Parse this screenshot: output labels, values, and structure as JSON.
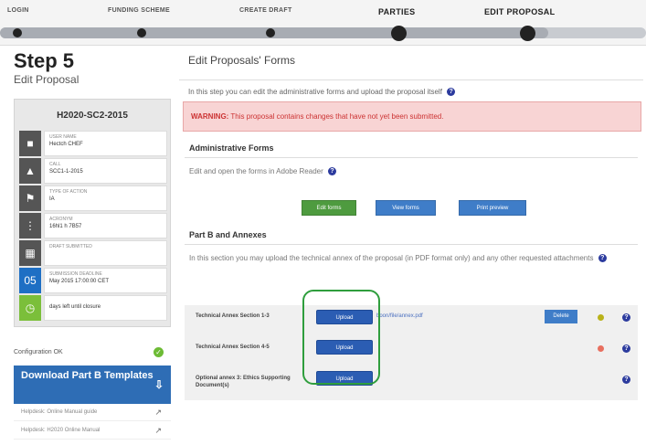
{
  "progress": {
    "steps": [
      {
        "label": "LOGIN",
        "active": false
      },
      {
        "label": "FUNDING SCHEME",
        "active": false
      },
      {
        "label": "CREATE DRAFT",
        "active": false
      },
      {
        "label": "PARTIES",
        "active": true
      },
      {
        "label": "EDIT PROPOSAL",
        "active": true
      }
    ]
  },
  "sidebar": {
    "step_title": "Step 5",
    "step_subtitle": "Edit Proposal",
    "proposal_id": "H2020-SC2-2015",
    "rows": [
      {
        "icon": "person-icon",
        "label": "USER NAME",
        "value": "Hectch CHEF"
      },
      {
        "icon": "call-icon",
        "label": "CALL",
        "value": "SCC1-1-2015"
      },
      {
        "icon": "topic-icon",
        "label": "TYPE OF ACTION",
        "value": "IA"
      },
      {
        "icon": "acronym-icon",
        "label": "ACRONYM",
        "value": "16hl1 h 7B57"
      },
      {
        "icon": "document-icon",
        "label": "DRAFT SUBMITTED",
        "value": ""
      },
      {
        "icon": "calendar-icon",
        "date": "05",
        "label": "SUBMISSION DEADLINE",
        "value": "May 2015 17:00:00 CET"
      },
      {
        "icon": "time-icon",
        "label": "",
        "value": "days left until closure"
      }
    ],
    "config_label": "Configuration OK",
    "download_label": "Download Part B Templates",
    "links": [
      "Helpdesk: Online Manual guide",
      "Helpdesk: H2020 Online Manual"
    ]
  },
  "main": {
    "title": "Edit Proposals' Forms",
    "intro": "In this step you can edit the administrative forms and upload the proposal itself",
    "warning_prefix": "WARNING:",
    "warning_text": "This proposal contains changes that have not yet been submitted.",
    "admin": {
      "title": "Administrative Forms",
      "text": "Edit and open the forms in Adobe Reader",
      "buttons": [
        "Edit forms",
        "View forms",
        "Print preview"
      ]
    },
    "annexes": {
      "title": "Part B and Annexes",
      "text": "In this section you may upload the technical annex of the proposal (in PDF format only) and any other requested attachments",
      "rows": [
        {
          "label": "Technical Annex Section 1-3",
          "upload": "Upload",
          "file": "boon/file/annex.pdf",
          "delete": "Delete",
          "status": "yellow"
        },
        {
          "label": "Technical Annex Section 4-5",
          "upload": "Upload",
          "file": "",
          "delete": "",
          "status": "red"
        },
        {
          "label": "Optional annex 3: Ethics Supporting Document(s)",
          "upload": "Upload",
          "file": "",
          "delete": "",
          "status": ""
        }
      ]
    }
  }
}
